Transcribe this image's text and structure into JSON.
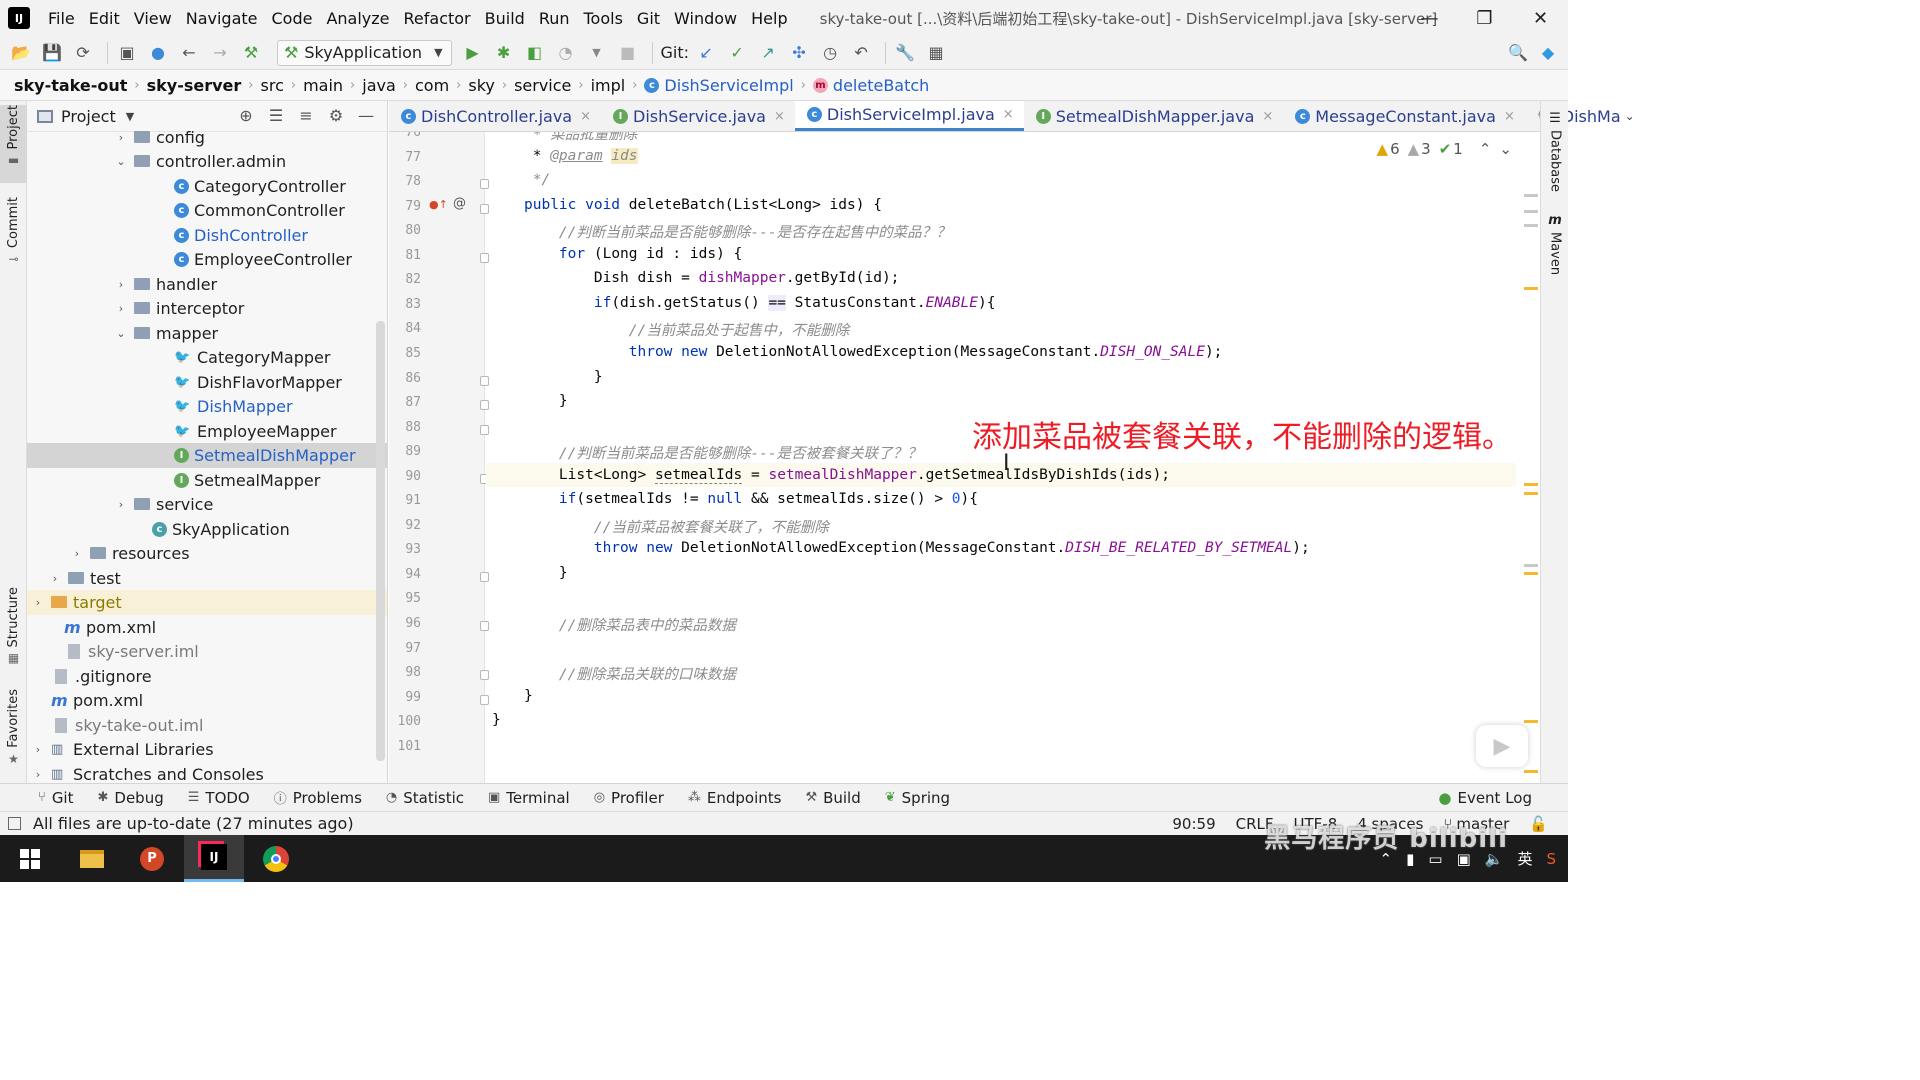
{
  "window": {
    "title": "sky-take-out [...\\资料\\后端初始工程\\sky-take-out] - DishServiceImpl.java [sky-server]",
    "logo": "IJ"
  },
  "menu": [
    "File",
    "Edit",
    "View",
    "Navigate",
    "Code",
    "Analyze",
    "Refactor",
    "Build",
    "Run",
    "Tools",
    "Git",
    "Window",
    "Help"
  ],
  "toolbar": {
    "run_config": "SkyApplication",
    "git_label": "Git:"
  },
  "breadcrumb": [
    "sky-take-out",
    "sky-server",
    "src",
    "main",
    "java",
    "com",
    "sky",
    "service",
    "impl",
    "DishServiceImpl",
    "deleteBatch"
  ],
  "left_strip": {
    "project": "Project",
    "commit": "Commit",
    "structure": "Structure",
    "favorites": "Favorites"
  },
  "right_strip": {
    "database": "Database",
    "maven": "Maven"
  },
  "project_panel": {
    "title": "Project",
    "tree": [
      {
        "label": "config",
        "kind": "folder",
        "arrow": "›"
      },
      {
        "label": "controller.admin",
        "kind": "folder",
        "arrow": "⌄"
      },
      {
        "label": "CategoryController",
        "kind": "class"
      },
      {
        "label": "CommonController",
        "kind": "class"
      },
      {
        "label": "DishController",
        "kind": "class",
        "color": "blue"
      },
      {
        "label": "EmployeeController",
        "kind": "class"
      },
      {
        "label": "handler",
        "kind": "folder",
        "arrow": "›"
      },
      {
        "label": "interceptor",
        "kind": "folder",
        "arrow": "›"
      },
      {
        "label": "mapper",
        "kind": "folder",
        "arrow": "⌄"
      },
      {
        "label": "CategoryMapper",
        "kind": "mapper"
      },
      {
        "label": "DishFlavorMapper",
        "kind": "mapper"
      },
      {
        "label": "DishMapper",
        "kind": "mapper",
        "color": "blue"
      },
      {
        "label": "EmployeeMapper",
        "kind": "mapper"
      },
      {
        "label": "SetmealDishMapper",
        "kind": "interface",
        "color": "blue",
        "selected": true
      },
      {
        "label": "SetmealMapper",
        "kind": "interface"
      },
      {
        "label": "service",
        "kind": "folder",
        "arrow": "›"
      },
      {
        "label": "SkyApplication",
        "kind": "app"
      },
      {
        "label": "resources",
        "kind": "folder",
        "arrow": "›"
      },
      {
        "label": "test",
        "kind": "folder",
        "arrow": "›"
      },
      {
        "label": "target",
        "kind": "folder-orange",
        "arrow": "›",
        "color": "olive"
      },
      {
        "label": "pom.xml",
        "kind": "pom"
      },
      {
        "label": "sky-server.iml",
        "kind": "file",
        "color": "grey"
      },
      {
        "label": ".gitignore",
        "kind": "file"
      },
      {
        "label": "pom.xml",
        "kind": "pom"
      },
      {
        "label": "sky-take-out.iml",
        "kind": "file",
        "color": "grey"
      },
      {
        "label": "External Libraries",
        "kind": "lib",
        "arrow": "›"
      },
      {
        "label": "Scratches and Consoles",
        "kind": "lib",
        "arrow": "›"
      }
    ]
  },
  "tabs": [
    {
      "label": "DishController.java",
      "icon": "c"
    },
    {
      "label": "DishService.java",
      "icon": "i"
    },
    {
      "label": "DishServiceImpl.java",
      "icon": "c",
      "active": true
    },
    {
      "label": "SetmealDishMapper.java",
      "icon": "i"
    },
    {
      "label": "MessageConstant.java",
      "icon": "c"
    },
    {
      "label": "DishMa",
      "icon": "m"
    }
  ],
  "inspections": {
    "warnings": "6",
    "weak_warnings": "3",
    "ok": "1"
  },
  "code": {
    "line_numbers": [
      "76",
      "77",
      "78",
      "79",
      "80",
      "81",
      "82",
      "83",
      "84",
      "85",
      "86",
      "87",
      "88",
      "89",
      "90",
      "91",
      "92",
      "93",
      "94",
      "95",
      "96",
      "97",
      "98",
      "99",
      "100",
      "101"
    ],
    "lines": {
      "l76": " * 菜品批量删除",
      "l77_tag": "@param",
      "l77_ids": "ids",
      "l78": " */",
      "l79_kw": "public void ",
      "l79_rest": "deleteBatch(List<Long> ids) {",
      "l80": "    //判断当前菜品是否能够删除---是否存在起售中的菜品？？",
      "l81_kw": "for",
      "l81_rest": " (Long id : ids) {",
      "l82_a": "        Dish dish = ",
      "l82_fld": "dishMapper",
      "l82_b": ".getById(id);",
      "l83_kw": "if",
      "l83_a": "(dish.getStatus() ",
      "l83_eq": "==",
      "l83_b": " StatusConstant.",
      "l83_st": "ENABLE",
      "l83_c": "){",
      "l84": "            //当前菜品处于起售中，不能删除",
      "l85_kw": "throw new ",
      "l85_a": "DeletionNotAllowedException(MessageConstant.",
      "l85_st": "DISH_ON_SALE",
      "l85_b": ");",
      "l86": "        }",
      "l87": "    }",
      "l89": "    //判断当前菜品是否能够删除---是否被套餐关联了？？",
      "l90_a": "    List<Long> ",
      "l90_var": "setmealIds",
      "l90_b": " = ",
      "l90_fld": "setmealDishMapper",
      "l90_c": ".getSetmealIdsByDishIds(ids);",
      "l91_kw": "if",
      "l91_a": "(setmealIds != ",
      "l91_null": "null",
      "l91_b": " && setmealIds.size() > ",
      "l91_num": "0",
      "l91_c": "){",
      "l92": "        //当前菜品被套餐关联了，不能删除",
      "l93_kw": "throw new ",
      "l93_a": "DeletionNotAllowedException(MessageConstant.",
      "l93_st": "DISH_BE_RELATED_BY_SETMEAL",
      "l93_b": ");",
      "l94": "    }",
      "l96": "    //删除菜品表中的菜品数据",
      "l98": "    //删除菜品关联的口味数据",
      "l99": "}",
      "l100": "}"
    }
  },
  "annotation": "添加菜品被套餐关联，不能删除的逻辑。",
  "bottom_tools": [
    "Git",
    "Debug",
    "TODO",
    "Problems",
    "Statistic",
    "Terminal",
    "Profiler",
    "Endpoints",
    "Build",
    "Spring"
  ],
  "event_log": "Event Log",
  "status": {
    "message": "All files are up-to-date (27 minutes ago)",
    "position": "90:59",
    "line_sep": "CRLF",
    "encoding": "UTF-8",
    "indent": "4 spaces",
    "branch": "master"
  },
  "tray": {
    "ime": "英"
  },
  "watermark": "黑马程序员 bilibili"
}
